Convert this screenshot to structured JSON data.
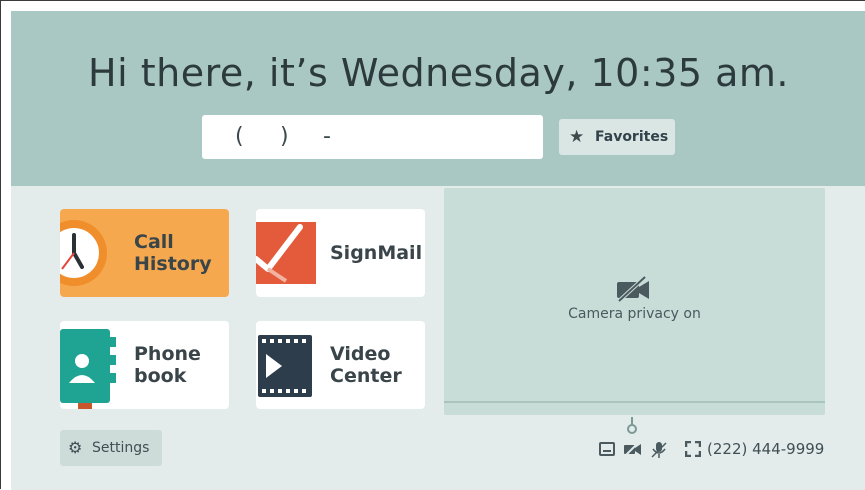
{
  "header": {
    "greeting": "Hi there, it’s Wednesday, 10:35 am.",
    "dial_open_paren": "(",
    "dial_close_paren": ")",
    "dial_dash": "-",
    "favorites_label": "Favorites",
    "background": "#a9c8c3"
  },
  "tiles": [
    {
      "label": "Call\nHistory",
      "icon": "clock-icon",
      "color": "#f5a84e"
    },
    {
      "label": "SignMail",
      "icon": "signmail-icon",
      "color": "#e45b3c"
    },
    {
      "label": "Phone\nbook",
      "icon": "phonebook-icon",
      "color": "#1fa393"
    },
    {
      "label": "Video\nCenter",
      "icon": "film-icon",
      "color": "#2e3d4b"
    }
  ],
  "camera": {
    "status_text": "Camera privacy on",
    "icon": "camera-off-icon"
  },
  "footer": {
    "settings_label": "Settings",
    "phone_number": "(222) 444-9999",
    "status_icons": [
      "caption-icon",
      "camera-off-icon",
      "mic-off-icon",
      "fullscreen-icon"
    ]
  }
}
